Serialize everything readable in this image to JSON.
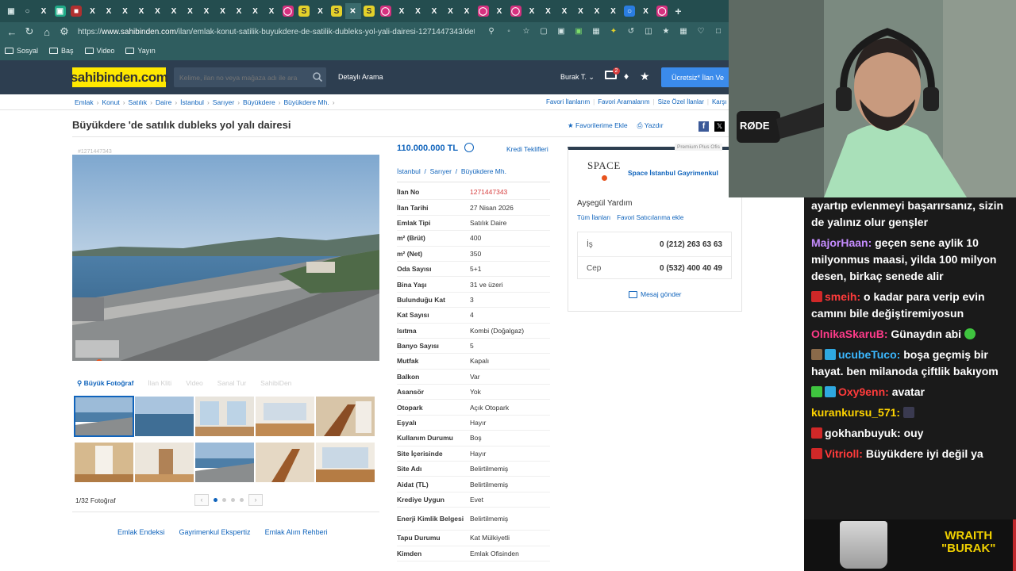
{
  "browser": {
    "url_prefix": "https://",
    "url_domain": "www.sahibinden.com",
    "url_path": "/ilan/emlak-konut-satilik-buyukdere-de-satilik-dubleks-yol-yali-dairesi-1271447343/detay",
    "bookmarks": [
      "Sosyal",
      "Baş",
      "Video",
      "Yayın"
    ]
  },
  "header": {
    "logo": "sahibinden.com",
    "search_placeholder": "Kelime, ilan no veya mağaza adı ile ara",
    "detailed_search": "Detaylı Arama",
    "user": "Burak T.",
    "message_badge": "2",
    "post_button": "Ücretsiz* İlan Ve"
  },
  "breadcrumb": [
    "Emlak",
    "Konut",
    "Satılık",
    "Daire",
    "İstanbul",
    "Sarıyer",
    "Büyükdere",
    "Büyükdere Mh."
  ],
  "top_links": [
    "Favori İlanlarım",
    "Favori Aramalarım",
    "Size Özel İlanlar",
    "Karşı"
  ],
  "listing": {
    "title": "Büyükdere 'de satılık dubleks yol yalı dairesi",
    "favorite": "Favorilerime Ekle",
    "print": "Yazdır",
    "small_no": "#1271447343",
    "price": "110.000.000 TL",
    "credit_link": "Kredi Teklifleri",
    "location": [
      "İstanbul",
      "Sarıyer",
      "Büyükdere Mh."
    ],
    "photo_tabs": [
      "Büyük Fotoğraf",
      "İlan Kliti",
      "Video",
      "Sanal Tur",
      "SahibiDen"
    ],
    "photo_count": "1/32 Fotoğraf",
    "details": [
      {
        "k": "İlan No",
        "v": "1271447343"
      },
      {
        "k": "İlan Tarihi",
        "v": "27 Nisan 2026"
      },
      {
        "k": "Emlak Tipi",
        "v": "Satılık Daire"
      },
      {
        "k": "m² (Brüt)",
        "v": "400"
      },
      {
        "k": "m² (Net)",
        "v": "350"
      },
      {
        "k": "Oda Sayısı",
        "v": "5+1"
      },
      {
        "k": "Bina Yaşı",
        "v": "31 ve üzeri"
      },
      {
        "k": "Bulunduğu Kat",
        "v": "3"
      },
      {
        "k": "Kat Sayısı",
        "v": "4"
      },
      {
        "k": "Isıtma",
        "v": "Kombi (Doğalgaz)"
      },
      {
        "k": "Banyo Sayısı",
        "v": "5"
      },
      {
        "k": "Mutfak",
        "v": "Kapalı"
      },
      {
        "k": "Balkon",
        "v": "Var"
      },
      {
        "k": "Asansör",
        "v": "Yok"
      },
      {
        "k": "Otopark",
        "v": "Açık Otopark"
      },
      {
        "k": "Eşyalı",
        "v": "Hayır"
      },
      {
        "k": "Kullanım Durumu",
        "v": "Boş"
      },
      {
        "k": "Site İçerisinde",
        "v": "Hayır"
      },
      {
        "k": "Site Adı",
        "v": "Belirtilmemiş"
      },
      {
        "k": "Aidat (TL)",
        "v": "Belirtilmemiş"
      },
      {
        "k": "Krediye Uygun",
        "v": "Evet"
      },
      {
        "k": "Enerji Kimlik Belgesi",
        "v": "Belirtilmemiş"
      },
      {
        "k": "Tapu Durumu",
        "v": "Kat Mülkiyetli"
      },
      {
        "k": "Kimden",
        "v": "Emlak Ofisinden"
      }
    ],
    "bottom_links": [
      "Emlak Endeksi",
      "Gayrimenkul Ekspertiz",
      "Emlak Alım Rehberi"
    ]
  },
  "agent": {
    "premium": "Premium Plus Ofis",
    "logo_text": "SPACE",
    "agency": "Space İstanbul Gayrimenkul",
    "name": "Ayşegül Yardım",
    "all_listings": "Tüm İlanları",
    "fav_seller": "Favori Satıcılarıma ekle",
    "phones": [
      {
        "label": "İş",
        "number": "0 (212) 263 63 63"
      },
      {
        "label": "Cep",
        "number": "0 (532) 400 40 49"
      }
    ],
    "message": "Mesaj gönder"
  },
  "chat": [
    {
      "user": "",
      "color": "#ffffff",
      "text": "ayartıp evlenmeyi başarırsanız, sizin de yalınız olur genşler"
    },
    {
      "user": "MajorHaan:",
      "color": "#c58cff",
      "text": "geçen sene aylik 10 milyonmus maasi, yilda 100 milyon desen, birkaç senede alir"
    },
    {
      "user": "smeih:",
      "color": "#ff3b3b",
      "text": "o kadar para verip evin camını bile değiştiremiyosun"
    },
    {
      "user": "OlnikaSkaruB:",
      "color": "#ff3b8a",
      "text": "Günaydın abi"
    },
    {
      "user": "ucubeTuco:",
      "color": "#3bb8ff",
      "text": "boşa geçmiş bir hayat. ben milanoda çiftlik bakıyom"
    },
    {
      "user": "Oxy9enn:",
      "color": "#ff3b3b",
      "text": "avatar"
    },
    {
      "user": "kurankursu_571:",
      "color": "#ffd400",
      "text": ""
    },
    {
      "user": "gokhanbuyuk:",
      "color": "#ffffff",
      "text": "ouy"
    },
    {
      "user": "Vitrioll:",
      "color": "#ff3b3b",
      "text": "Büyükdere iyi değil ya"
    }
  ],
  "overlay": {
    "brand_line1": "WRAITH",
    "brand_line2": "\"BURAK\""
  },
  "colors": {
    "link": "#1064bc",
    "header": "#2d3e50",
    "logo_bg": "#ffe800",
    "post_button": "#3b8beb"
  }
}
